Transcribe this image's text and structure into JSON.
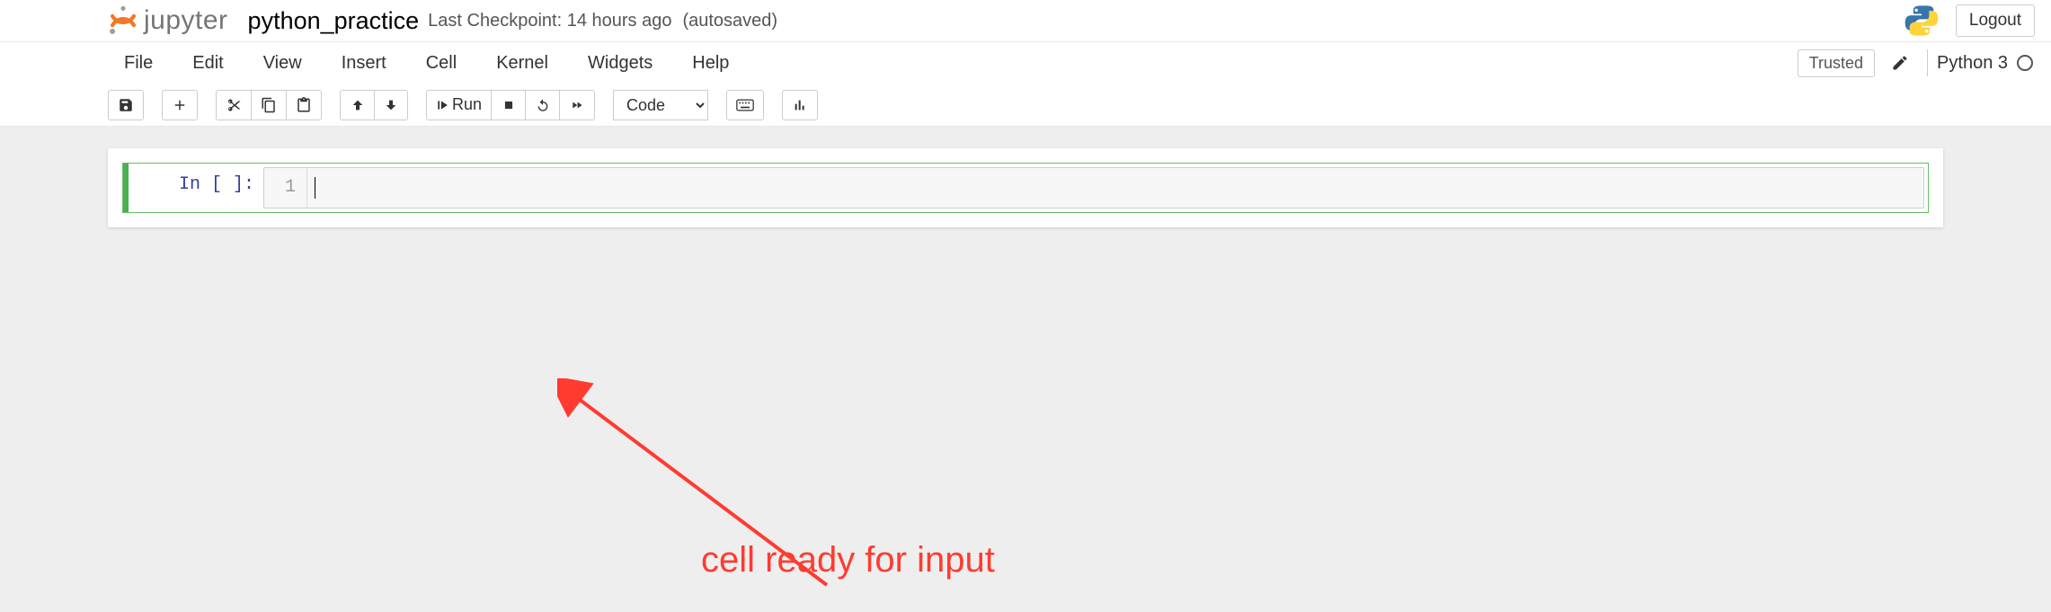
{
  "header": {
    "logo_text": "jupyter",
    "notebook_name": "python_practice",
    "checkpoint_text": "Last Checkpoint: 14 hours ago",
    "autosave_text": "(autosaved)",
    "logout_label": "Logout"
  },
  "menubar": {
    "items": [
      "File",
      "Edit",
      "View",
      "Insert",
      "Cell",
      "Kernel",
      "Widgets",
      "Help"
    ],
    "trusted_label": "Trusted",
    "kernel_name": "Python 3"
  },
  "toolbar": {
    "run_label": "Run",
    "cell_type_selected": "Code"
  },
  "cell": {
    "prompt": "In [ ]:",
    "line_number": "1",
    "content": ""
  },
  "annotation": {
    "text": "cell ready for input"
  }
}
